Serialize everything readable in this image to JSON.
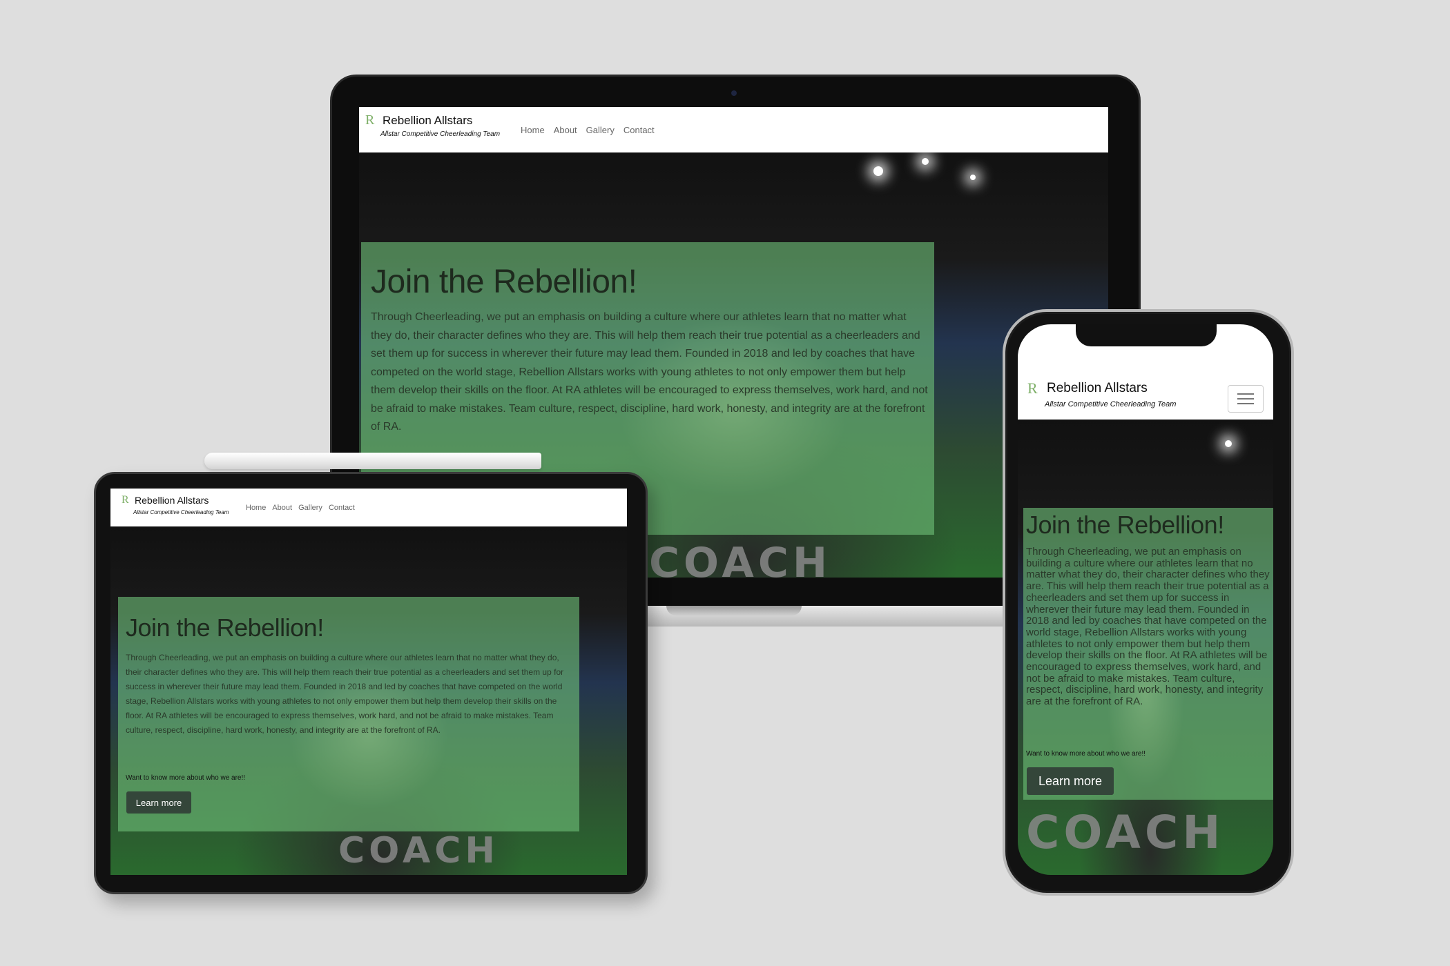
{
  "brand": {
    "mark": "R",
    "name": "Rebellion Allstars",
    "tagline": "Allstar Competitive Cheerleading Team"
  },
  "nav": {
    "items": [
      "Home",
      "About",
      "Gallery",
      "Contact"
    ]
  },
  "hero": {
    "title": "Join the Rebellion!",
    "body": "Through Cheerleading, we put an emphasis on building a culture where our athletes learn that no matter what they do, their character defines who they are. This will help them reach their true potential as a cheerleaders and set them up for success in wherever their future may lead them. Founded in 2018 and led by coaches that have competed on the world stage, Rebellion Allstars works with young athletes to not only empower them but help them develop their skills on the floor. At RA athletes will be encouraged to express themselves, work hard, and not be afraid to make mistakes. Team culture, respect, discipline, hard work, honesty, and integrity are at the forefront of RA.",
    "cta_question": "Want to know more about who we are!!",
    "cta_button": "Learn more",
    "background_text": "COACH"
  },
  "colors": {
    "background": "#dedede",
    "panel_green": "#6ebe78",
    "button_dark": "#34463a",
    "brand_mark": "#7fb069"
  }
}
